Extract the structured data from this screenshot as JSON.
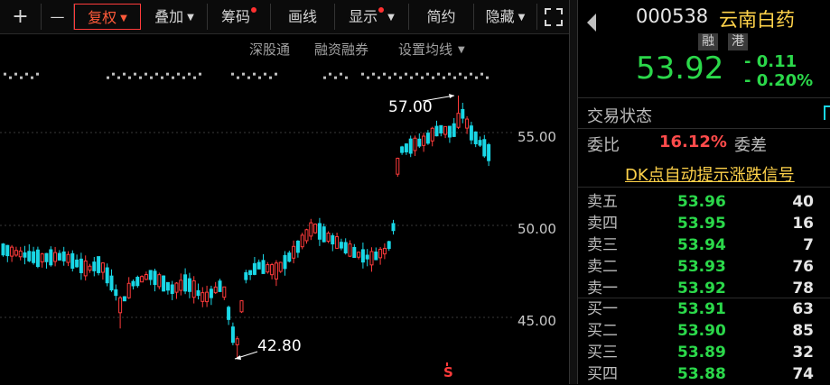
{
  "toolbar": {
    "items": [
      {
        "label": "+",
        "icon": "zoom-in-icon"
      },
      {
        "label": "—",
        "icon": "zoom-out-icon"
      },
      {
        "label": "复权"
      },
      {
        "label": "叠加"
      },
      {
        "label": "筹码"
      },
      {
        "label": "画线"
      },
      {
        "label": "显示"
      },
      {
        "label": "简约"
      },
      {
        "label": "隐藏"
      }
    ],
    "expand_icon": "expand-icon"
  },
  "sublinks": {
    "shenguton": "深股通",
    "rongzi": "融资融券",
    "junxian": "设置均线"
  },
  "chart": {
    "price_ticks": [
      "55.00",
      "50.00",
      "45.00"
    ],
    "high_label": "57.00",
    "low_label": "42.80",
    "s_marker": "S",
    "colors": {
      "up": "#ff3b3b",
      "down": "#19d7e6",
      "grid": "#3a3a3a"
    }
  },
  "quote": {
    "code": "000538",
    "name": "云南白药",
    "tag_rong": "融",
    "tag_gang": "港",
    "price": "53.92",
    "change": "- 0.11",
    "change_pct": "- 0.20%",
    "trade_status_label": "交易状态",
    "weibi_label": "委比",
    "weibi_value": "16.12%",
    "weicha_label": "委差",
    "dk_text": "DK点自动提示涨跌信号"
  },
  "orderbook": {
    "asks": [
      {
        "label": "卖五",
        "price": "53.96",
        "vol": "40"
      },
      {
        "label": "卖四",
        "price": "53.95",
        "vol": "16"
      },
      {
        "label": "卖三",
        "price": "53.94",
        "vol": "7"
      },
      {
        "label": "卖二",
        "price": "53.93",
        "vol": "76"
      },
      {
        "label": "卖一",
        "price": "53.92",
        "vol": "78"
      }
    ],
    "bids": [
      {
        "label": "买一",
        "price": "53.91",
        "vol": "63"
      },
      {
        "label": "买二",
        "price": "53.90",
        "vol": "85"
      },
      {
        "label": "买三",
        "price": "53.89",
        "vol": "32"
      },
      {
        "label": "买四",
        "price": "53.88",
        "vol": "74"
      }
    ],
    "colors": {
      "price": "#2bd84a",
      "vol": "#e6e6e6",
      "label": "#bdbdbd"
    }
  }
}
